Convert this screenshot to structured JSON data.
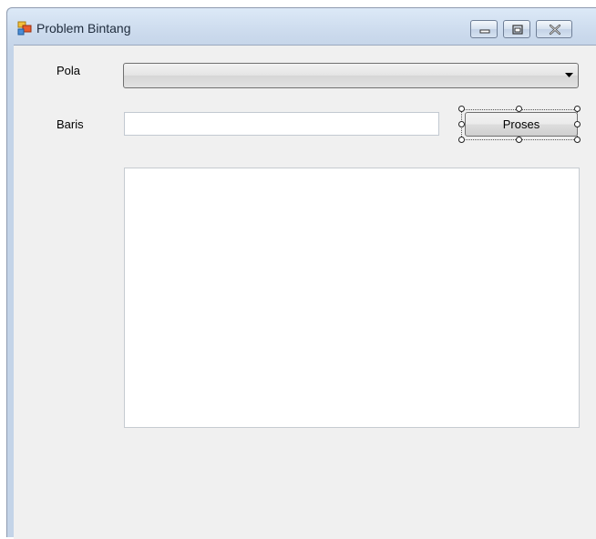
{
  "window": {
    "title": "Problem Bintang",
    "icon": "form-app-icon",
    "controls": [
      "minimize-icon",
      "maximize-icon",
      "close-icon"
    ]
  },
  "form": {
    "pola_label": "Pola",
    "pola_value": "",
    "baris_label": "Baris",
    "baris_value": "",
    "proses_button": "Proses",
    "output_text": ""
  },
  "colors": {
    "form_background": "#f0f0f0",
    "titlebar": "#cad9ec"
  }
}
